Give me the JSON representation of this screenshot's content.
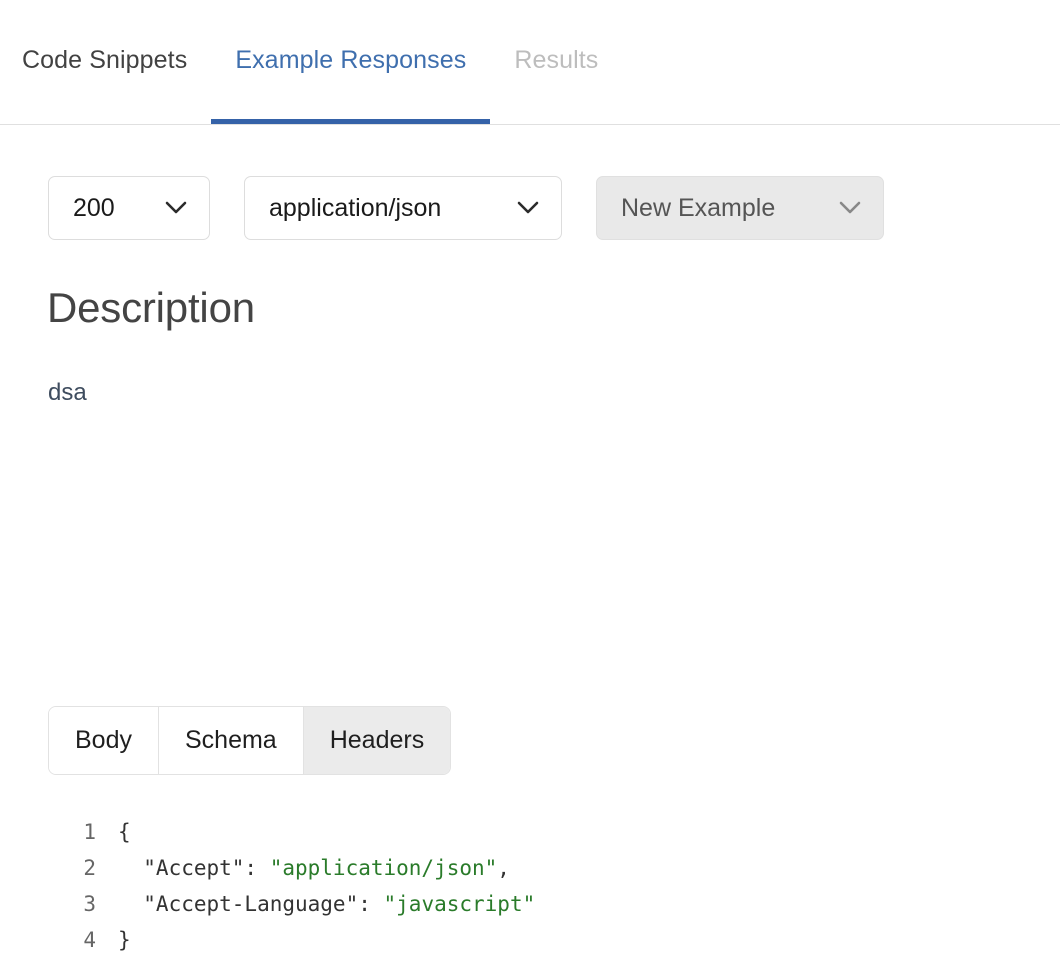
{
  "tabs": [
    {
      "label": "Code Snippets",
      "state": "inactive"
    },
    {
      "label": "Example Responses",
      "state": "active"
    },
    {
      "label": "Results",
      "state": "disabled"
    }
  ],
  "selectors": {
    "status": {
      "value": "200",
      "icon": "chevron-down-icon"
    },
    "content_type": {
      "value": "application/json",
      "icon": "chevron-down-icon"
    },
    "example": {
      "value": "New Example",
      "icon": "chevron-down-icon"
    }
  },
  "description": {
    "heading": "Description",
    "text": "dsa"
  },
  "response_tabs": [
    {
      "label": "Body",
      "active": false
    },
    {
      "label": "Schema",
      "active": false
    },
    {
      "label": "Headers",
      "active": true
    }
  ],
  "code": {
    "lines": [
      {
        "number": "1",
        "plain_1": "{",
        "string_1": "",
        "plain_2": ""
      },
      {
        "number": "2",
        "plain_1": "  \"Accept\": ",
        "string_1": "\"application/json\"",
        "plain_2": ","
      },
      {
        "number": "3",
        "plain_1": "  \"Accept-Language\": ",
        "string_1": "\"javascript\"",
        "plain_2": ""
      },
      {
        "number": "4",
        "plain_1": "}",
        "string_1": "",
        "plain_2": ""
      }
    ]
  },
  "colors": {
    "accent_blue": "#3562a8",
    "active_tab_text": "#3f6fae",
    "disabled_tab_text": "#bdbdbd",
    "string_green": "#2a7b2a",
    "description_text": "#3e4c5e",
    "segment_active_bg": "#ebebeb",
    "example_dropdown_bg": "#e9e9e9"
  }
}
